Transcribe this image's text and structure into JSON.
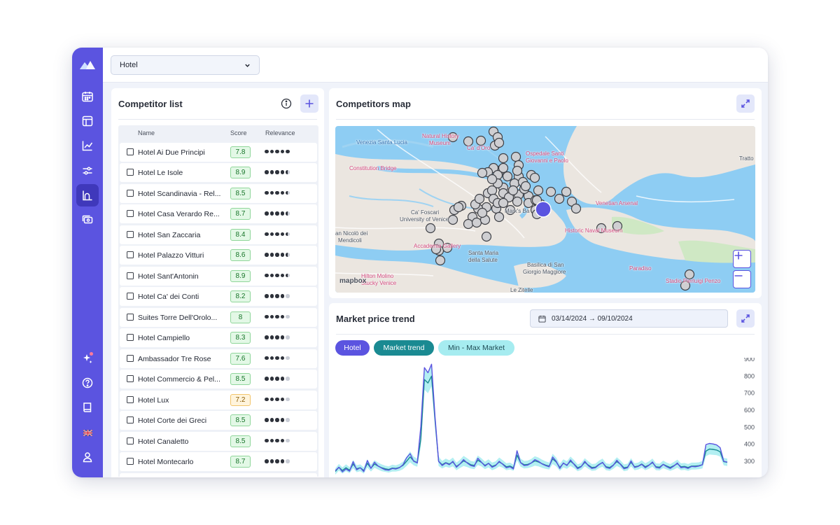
{
  "topbar": {
    "selected_hotel": "Hotel"
  },
  "competitor_list": {
    "title": "Competitor list",
    "columns": [
      "Name",
      "Score",
      "Relevance"
    ],
    "rows": [
      {
        "name": "Hotel Ai Due Principi",
        "score": "7.8",
        "relevance": 5
      },
      {
        "name": "Hotel Le Isole",
        "score": "8.9",
        "relevance": 4.5
      },
      {
        "name": "Hotel Scandinavia - Rel...",
        "score": "8.5",
        "relevance": 4.5
      },
      {
        "name": "Hotel Casa Verardo Re...",
        "score": "8.7",
        "relevance": 4.5
      },
      {
        "name": "Hotel San Zaccaria",
        "score": "8.4",
        "relevance": 4.5
      },
      {
        "name": "Hotel Palazzo Vitturi",
        "score": "8.6",
        "relevance": 4.5
      },
      {
        "name": "Hotel Sant'Antonin",
        "score": "8.9",
        "relevance": 4.5
      },
      {
        "name": "Hotel Ca' dei Conti",
        "score": "8.2",
        "relevance": 4
      },
      {
        "name": "Suites Torre Dell'Orolo...",
        "score": "8",
        "relevance": 4
      },
      {
        "name": "Hotel Campiello",
        "score": "8.3",
        "relevance": 4
      },
      {
        "name": "Ambassador Tre Rose",
        "score": "7.6",
        "relevance": 4
      },
      {
        "name": "Hotel Commercio & Pel...",
        "score": "8.5",
        "relevance": 4
      },
      {
        "name": "Hotel Lux",
        "score": "7.2",
        "relevance": 4
      },
      {
        "name": "Hotel Corte dei Greci",
        "score": "8.5",
        "relevance": 4
      },
      {
        "name": "Hotel Canaletto",
        "score": "8.5",
        "relevance": 4
      },
      {
        "name": "Hotel Montecarlo",
        "score": "8.7",
        "relevance": 4
      },
      {
        "name": "",
        "score": "",
        "relevance": 0
      }
    ]
  },
  "map": {
    "title": "Competitors map",
    "labels": {
      "venezia_santa_lucia": "Venezia Santa Lucia",
      "natural_history": "Natural History",
      "museum": "Museum",
      "ca_doro": "Ca' d'Oro",
      "ospedale_1": "Ospedale Santi",
      "ospedale_2": "Giovanni e Paolo",
      "constitution_bridge": "Constitution Bridge",
      "trattoria": "Tratto",
      "ca_foscari": "Ca' Foscari",
      "university": "University of Venice",
      "san_marco": "Mark's Ba",
      "venetian_arsenal": "Venetian Arsenal",
      "san_nicolo_1": "an Nicolò dei",
      "san_nicolo_2": "Mendicoli",
      "accademia": "Accademia Gallery",
      "historic_naval": "Historic Naval Museum",
      "santa_maria_1": "Santa Maria",
      "santa_maria_2": "della Salute",
      "hilton_1": "Hilton Molino",
      "hilton_2": "Stucky Venice",
      "basilica_1": "Basilica di San",
      "basilica_2": "Giorgio Maggiore",
      "paradiso": "Paradiso",
      "stadio": "Stadio Pierluigi Penzo",
      "le_zitelle": "Le Zitelle",
      "mapbox": "mapbox"
    }
  },
  "trend": {
    "title": "Market price trend",
    "date_range": "03/14/2024 → 09/10/2024",
    "legend": {
      "hotel": "Hotel",
      "market": "Market trend",
      "minmax": "Min - Max Market"
    }
  },
  "colors": {
    "accent": "#5b54e0",
    "market": "#1a8a92",
    "band": "#a6ecf0",
    "score_green": "#18752a",
    "score_yellow": "#8a5a00"
  },
  "chart_data": {
    "type": "line",
    "title": "Market price trend",
    "xlabel": "",
    "ylabel": "",
    "yticks": [
      300,
      400,
      500,
      600,
      700,
      800,
      900
    ],
    "ylim": [
      230,
      900
    ],
    "series": [
      {
        "name": "Hotel",
        "values": [
          245,
          265,
          238,
          255,
          242,
          298,
          250,
          262,
          240,
          305,
          258,
          295,
          272,
          260,
          250,
          248,
          258,
          255,
          262,
          280,
          320,
          345,
          300,
          290,
          505,
          850,
          820,
          870,
          560,
          300,
          275,
          290,
          280,
          300,
          265,
          285,
          310,
          290,
          275,
          270,
          318,
          295,
          272,
          288,
          265,
          275,
          300,
          282,
          262,
          268,
          255,
          362,
          292,
          275,
          278,
          290,
          310,
          300,
          285,
          275,
          268,
          325,
          300,
          258,
          290,
          275,
          308,
          282,
          256,
          268,
          300,
          274,
          258,
          262,
          280,
          294,
          264,
          258,
          276,
          306,
          282,
          256,
          262,
          302,
          264,
          270,
          282,
          262,
          276,
          296,
          264,
          260,
          282,
          268,
          258,
          272,
          290,
          262,
          266,
          258,
          270,
          268,
          272,
          280,
          398,
          405,
          402,
          396,
          380,
          300,
          295
        ]
      },
      {
        "name": "Market trend",
        "values": [
          240,
          265,
          246,
          262,
          248,
          284,
          256,
          262,
          246,
          288,
          260,
          284,
          272,
          262,
          256,
          252,
          260,
          258,
          264,
          276,
          300,
          326,
          302,
          292,
          430,
          780,
          760,
          800,
          540,
          300,
          280,
          292,
          284,
          296,
          270,
          285,
          302,
          292,
          280,
          276,
          306,
          294,
          276,
          288,
          270,
          278,
          296,
          284,
          268,
          272,
          262,
          336,
          292,
          280,
          282,
          290,
          302,
          296,
          286,
          278,
          272,
          314,
          296,
          264,
          288,
          278,
          300,
          284,
          262,
          270,
          294,
          278,
          264,
          266,
          282,
          292,
          268,
          264,
          278,
          298,
          284,
          262,
          266,
          294,
          268,
          272,
          284,
          268,
          278,
          292,
          268,
          266,
          282,
          272,
          264,
          274,
          286,
          268,
          270,
          264,
          272,
          272,
          274,
          280,
          360,
          372,
          370,
          366,
          356,
          298,
          294
        ]
      },
      {
        "name": "Min - Max Market",
        "band_width": [
          18,
          20,
          18,
          20,
          18,
          24,
          20,
          20,
          18,
          24,
          20,
          22,
          20,
          20,
          18,
          18,
          20,
          18,
          20,
          22,
          28,
          32,
          26,
          24,
          42,
          60,
          60,
          60,
          46,
          28,
          22,
          24,
          22,
          26,
          22,
          24,
          30,
          26,
          22,
          22,
          28,
          24,
          22,
          24,
          22,
          22,
          26,
          22,
          20,
          20,
          18,
          30,
          24,
          22,
          22,
          24,
          28,
          26,
          24,
          22,
          20,
          30,
          26,
          20,
          24,
          22,
          28,
          24,
          20,
          20,
          24,
          22,
          20,
          20,
          22,
          24,
          20,
          20,
          22,
          26,
          22,
          20,
          20,
          24,
          20,
          20,
          22,
          20,
          22,
          24,
          20,
          20,
          22,
          20,
          20,
          22,
          24,
          20,
          20,
          20,
          20,
          20,
          20,
          22,
          30,
          32,
          32,
          30,
          28,
          22,
          22
        ]
      }
    ]
  }
}
